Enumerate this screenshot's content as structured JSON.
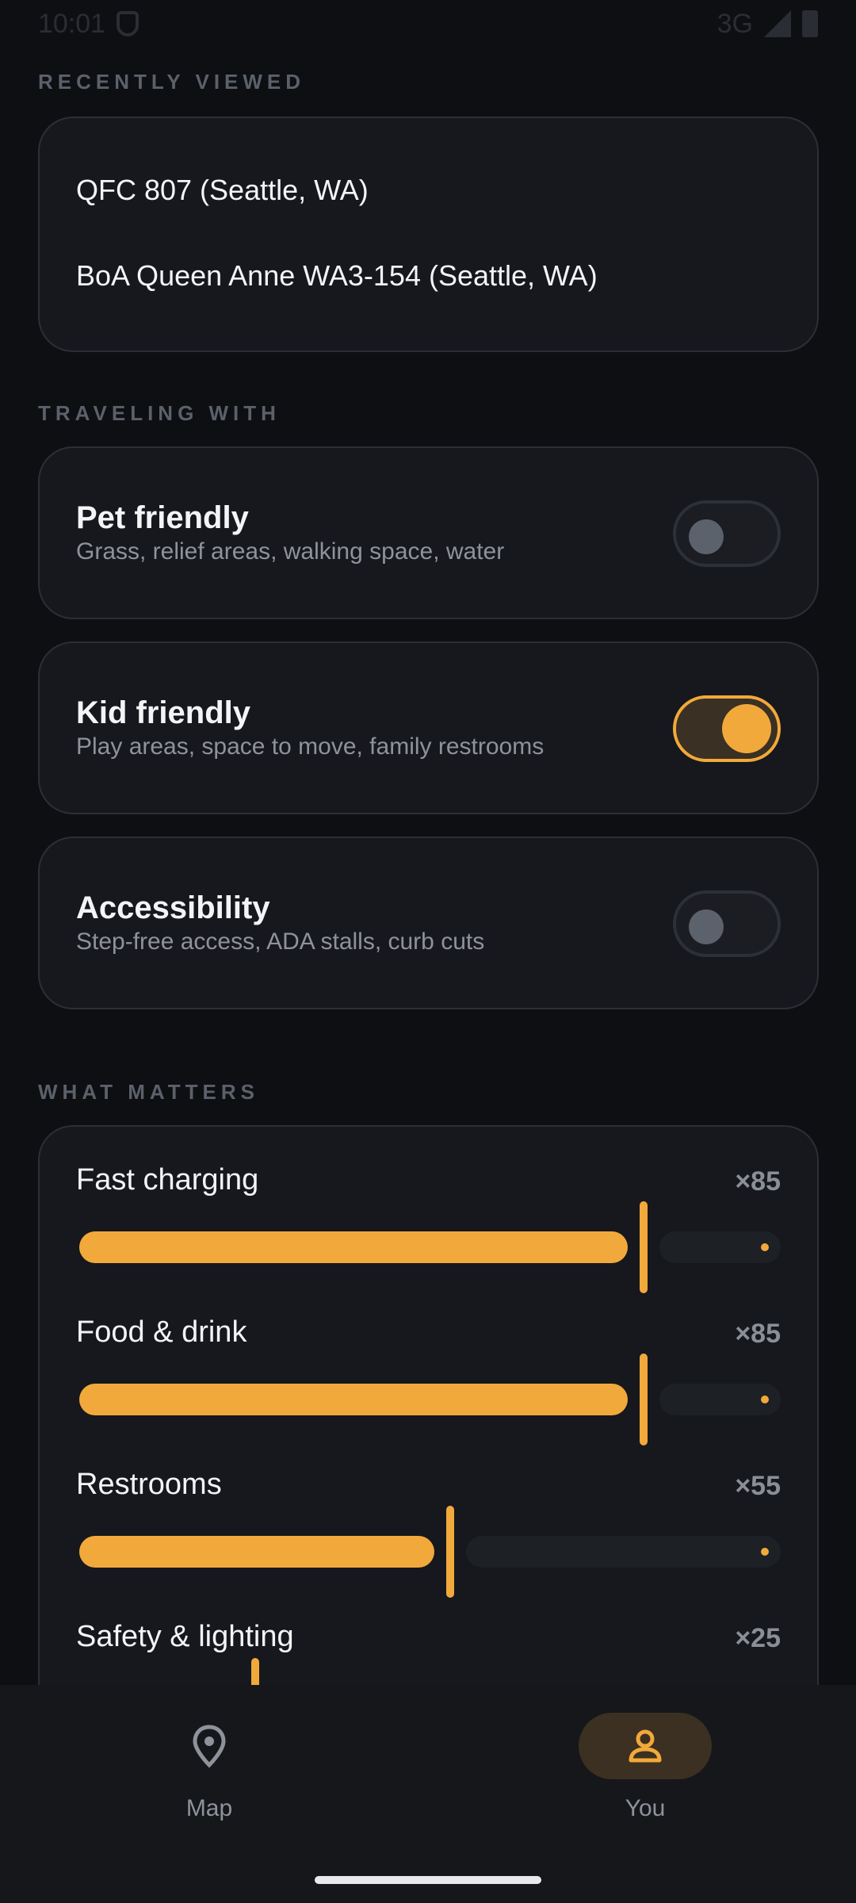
{
  "status": {
    "time": "10:01",
    "network": "3G"
  },
  "sections": {
    "recent": "RECENTLY VIEWED",
    "traveling": "TRAVELING WITH",
    "matters": "WHAT MATTERS"
  },
  "recent_items": [
    "QFC 807 (Seattle, WA)",
    "BoA Queen Anne WA3-154 (Seattle, WA)"
  ],
  "traveling": [
    {
      "title": "Pet friendly",
      "subtitle": "Grass, relief areas, walking space, water",
      "on": false
    },
    {
      "title": "Kid friendly",
      "subtitle": "Play areas, space to move, family restrooms",
      "on": true
    },
    {
      "title": "Accessibility",
      "subtitle": "Step-free access, ADA stalls, curb cuts",
      "on": false
    }
  ],
  "matters": [
    {
      "label": "Fast charging",
      "multiplier": "×85",
      "level": 85
    },
    {
      "label": "Food & drink",
      "multiplier": "×85",
      "level": 85
    },
    {
      "label": "Restrooms",
      "multiplier": "×55",
      "level": 55
    },
    {
      "label": "Safety & lighting",
      "multiplier": "×25",
      "level": 25
    }
  ],
  "nav": {
    "map": "Map",
    "you": "You"
  },
  "colors": {
    "accent": "#f2a93b",
    "background": "#0e0f12",
    "card": "#16181d"
  }
}
